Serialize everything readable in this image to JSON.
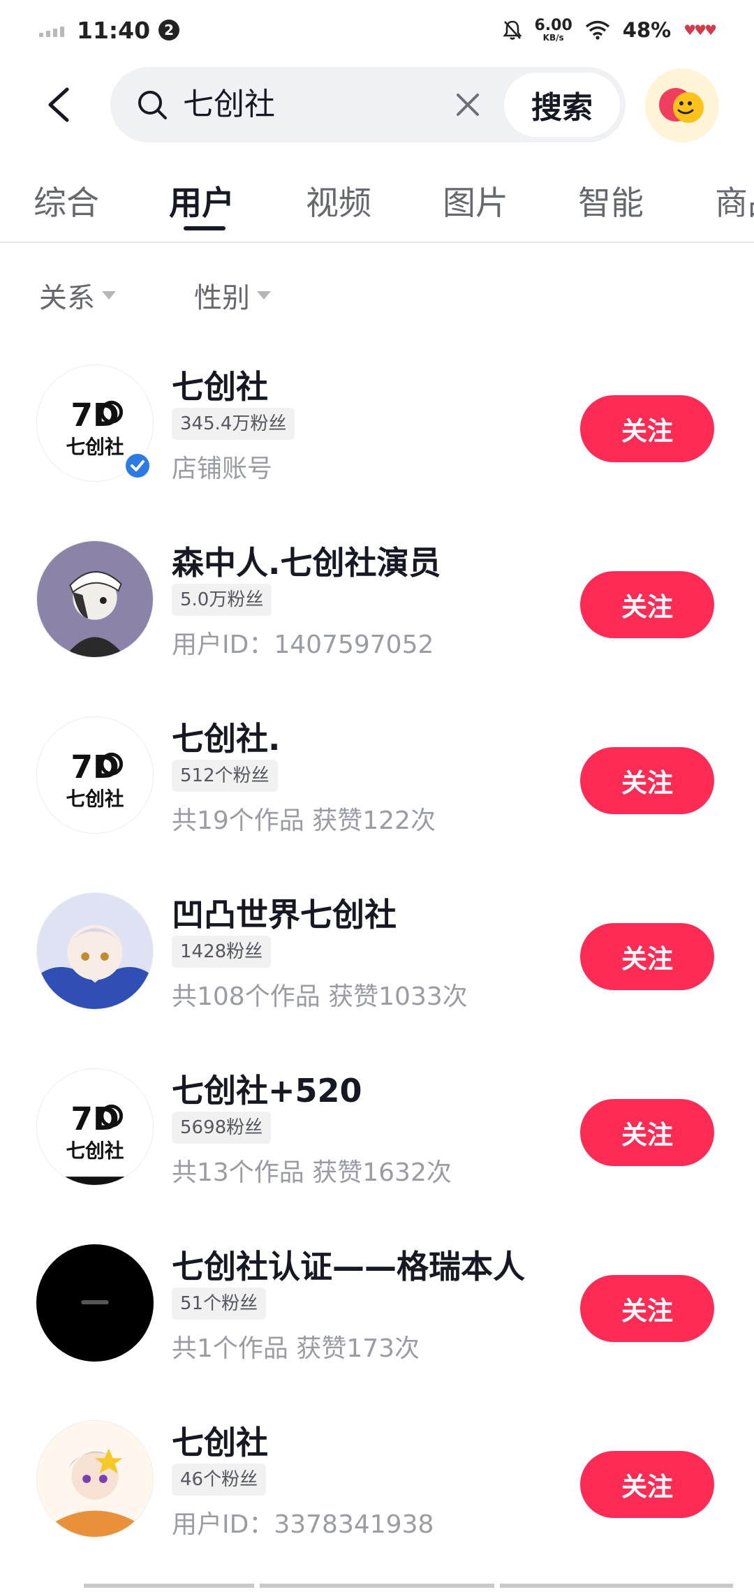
{
  "status_bar": {
    "time": "11:40",
    "notification_count": "2",
    "net_speed": "6.00",
    "net_unit": "KB/s",
    "battery": "48%"
  },
  "search": {
    "query": "七创社",
    "search_button": "搜索"
  },
  "tabs": [
    {
      "label": "综合"
    },
    {
      "label": "用户"
    },
    {
      "label": "视频"
    },
    {
      "label": "图片"
    },
    {
      "label": "智能"
    },
    {
      "label": "商品"
    }
  ],
  "active_tab": "用户",
  "filters": [
    {
      "label": "关系"
    },
    {
      "label": "性别"
    }
  ],
  "users": [
    {
      "name": "七创社",
      "fans": "345.4万粉丝",
      "sub": "店铺账号",
      "follow": "关注",
      "avatar": "qcs-logo-icon",
      "verified": true
    },
    {
      "name": "森中人.七创社演员",
      "fans": "5.0万粉丝",
      "sub": "用户ID：1407597052",
      "follow": "关注",
      "avatar": "anime-character-avatar-icon"
    },
    {
      "name": "七创社.",
      "fans": "512个粉丝",
      "sub": "共19个作品 获赞122次",
      "follow": "关注",
      "avatar": "qcs-logo-icon"
    },
    {
      "name": "凹凸世界七创社",
      "fans": "1428粉丝",
      "sub": "共108个作品 获赞1033次",
      "follow": "关注",
      "avatar": "anime-girl-avatar-icon"
    },
    {
      "name": "七创社+520",
      "fans": "5698粉丝",
      "sub": "共13个作品 获赞1632次",
      "follow": "关注",
      "avatar": "qcs-logo-icon"
    },
    {
      "name": "七创社认证——格瑞本人",
      "fans": "51个粉丝",
      "sub": "共1个作品 获赞173次",
      "follow": "关注",
      "avatar": "black-circle-avatar-icon"
    },
    {
      "name": "七创社",
      "fans": "46个粉丝",
      "sub": "用户ID：3378341938",
      "follow": "关注",
      "avatar": "chibi-character-avatar-icon"
    }
  ],
  "colors": {
    "follow_button": "#fe2c55",
    "verified_badge": "#2c7be5",
    "search_box": "#f0f1f4"
  }
}
